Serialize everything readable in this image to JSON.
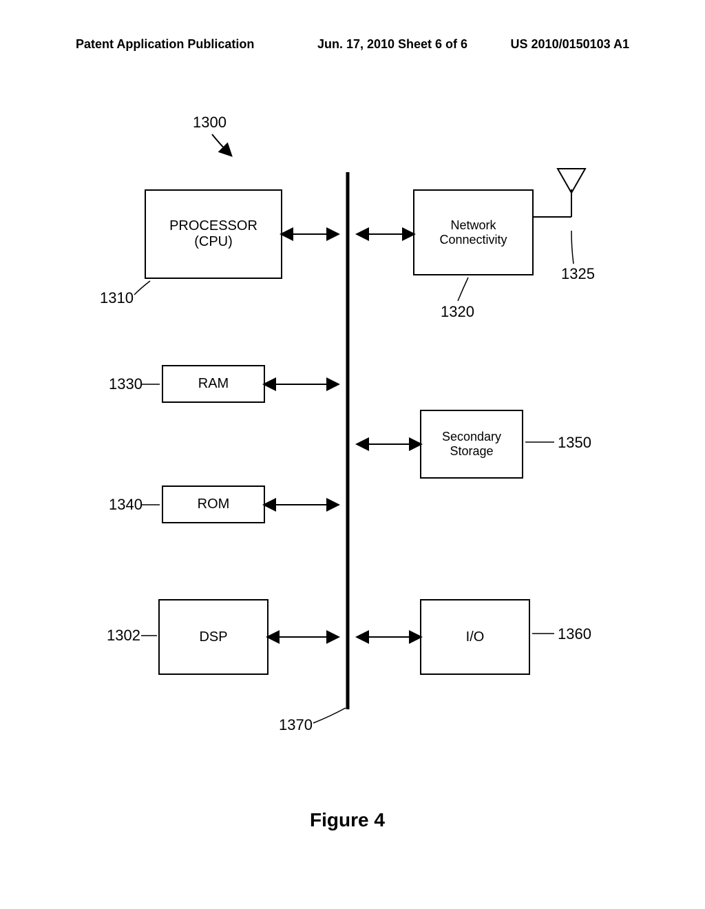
{
  "header": {
    "left": "Patent Application Publication",
    "mid": "Jun. 17, 2010   Sheet 6 of 6",
    "right": "US 2010/0150103 A1"
  },
  "refs": {
    "system": "1300",
    "cpu": "1310",
    "net": "1320",
    "antenna": "1325",
    "ram": "1330",
    "rom": "1340",
    "storage": "1350",
    "io": "1360",
    "bus": "1370",
    "dsp": "1302"
  },
  "blocks": {
    "cpu": "PROCESSOR\n(CPU)",
    "net": "Network\nConnectivity",
    "ram": "RAM",
    "rom": "ROM",
    "storage": "Secondary\nStorage",
    "dsp": "DSP",
    "io": "I/O"
  },
  "caption": "Figure 4"
}
